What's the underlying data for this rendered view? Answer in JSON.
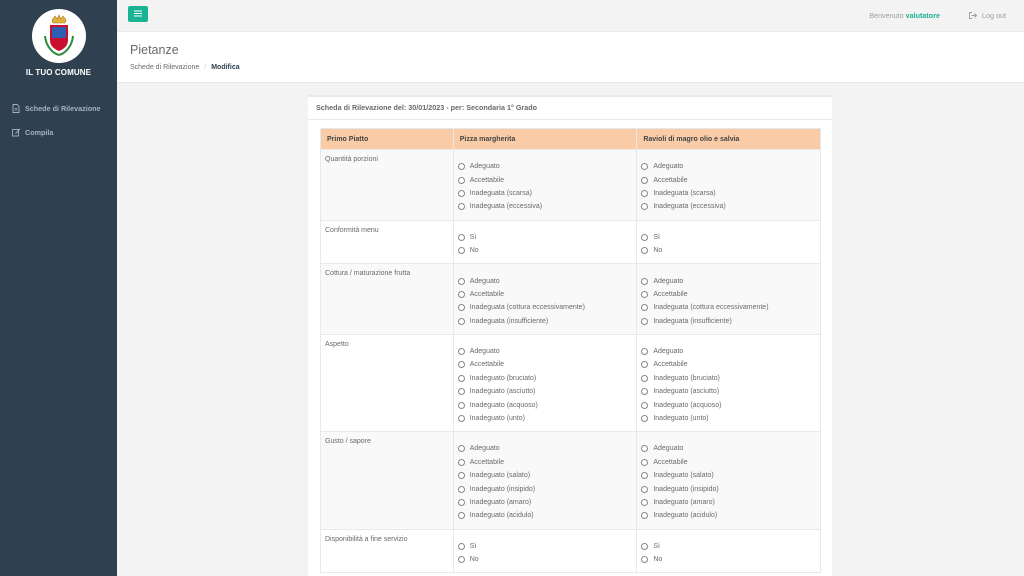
{
  "colors": {
    "sidebar": "#2f4050",
    "accent": "#1ab394",
    "table_header": "#f9cca7"
  },
  "sidebar": {
    "brand": "IL TUO COMUNE",
    "items": [
      {
        "label": "Schede di Rilevazione",
        "icon": "file-icon"
      },
      {
        "label": "Compila",
        "icon": "edit-icon"
      }
    ]
  },
  "topbar": {
    "menu_icon": "hamburger-icon",
    "welcome": "Benvenuto",
    "user": "valutatore",
    "logout": "Log out"
  },
  "heading": {
    "title": "Pietanze",
    "breadcrumb": [
      "Schede di Rilevazione",
      "Modifica"
    ]
  },
  "panel": {
    "title": "Scheda di Rilevazione del: 30/01/2023 - per: Secondaria 1° Grado",
    "columns": [
      "Primo Piatto",
      "Pizza margherita",
      "Ravioli di magro olio e salvia"
    ],
    "rows": [
      {
        "label": "Quantità porzioni",
        "options": [
          "Adeguato",
          "Accettabile",
          "Inadeguata (scarsa)",
          "Inadeguata (eccessiva)"
        ]
      },
      {
        "label": "Conformità menu",
        "options": [
          "Sì",
          "No"
        ]
      },
      {
        "label": "Cottura / maturazione frutta",
        "options": [
          "Adeguato",
          "Accettabile",
          "Inadeguata (cottura eccessivamente)",
          "Inadeguata (insufficiente)"
        ]
      },
      {
        "label": "Aspetto",
        "options": [
          "Adeguato",
          "Accettabile",
          "Inadeguato (bruciato)",
          "Inadeguato (asciutto)",
          "Inadeguato (acquoso)",
          "Inadeguato (unto)"
        ]
      },
      {
        "label": "Gusto / sapore",
        "options": [
          "Adeguato",
          "Accettabile",
          "Inadeguato (salato)",
          "Inadeguato (insipido)",
          "Inadeguato (amaro)",
          "Inadeguato (acidulo)"
        ]
      },
      {
        "label": "Disponibilità a fine servizio",
        "options": [
          "Sì",
          "No"
        ]
      }
    ]
  }
}
